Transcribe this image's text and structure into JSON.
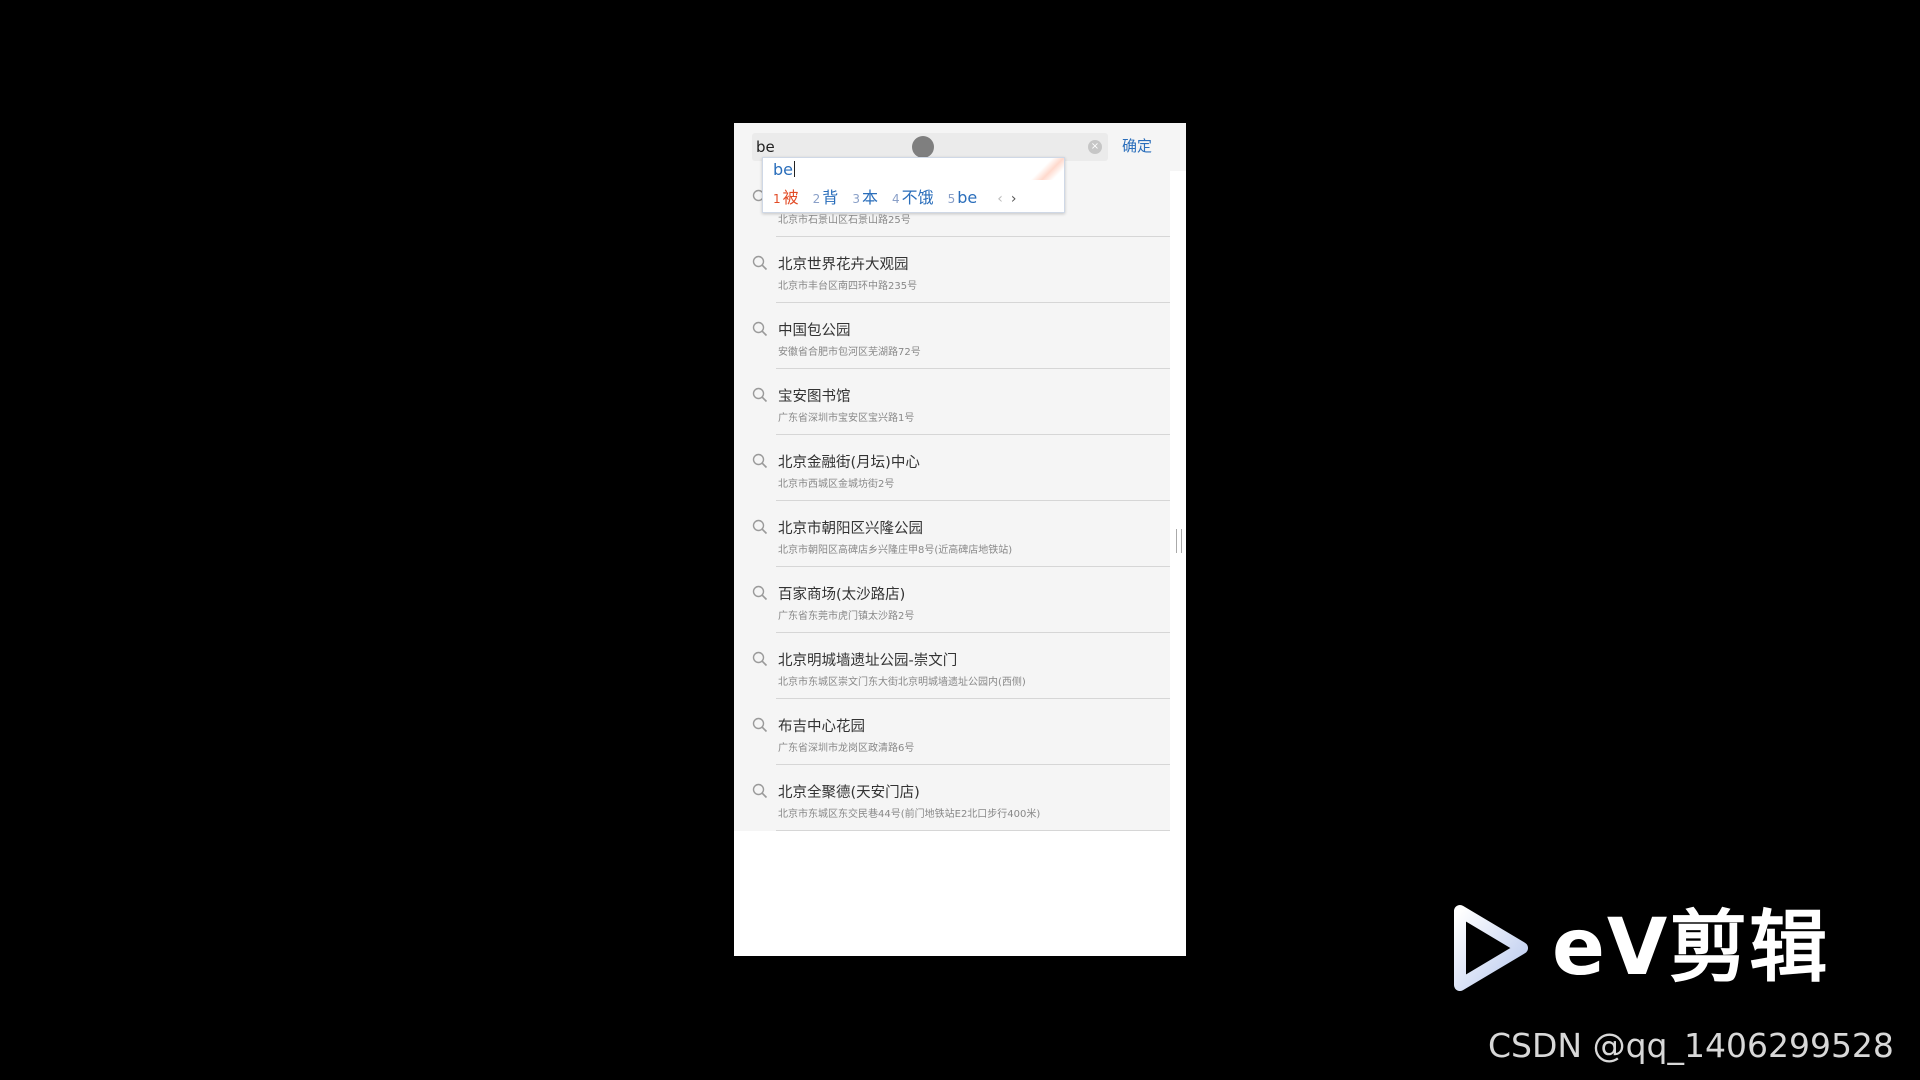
{
  "header": {
    "search_value": "be",
    "confirm_label": "确定"
  },
  "ime": {
    "composition": "be",
    "candidates": [
      {
        "num": "1",
        "text": "被"
      },
      {
        "num": "2",
        "text": "背"
      },
      {
        "num": "3",
        "text": "本"
      },
      {
        "num": "4",
        "text": "不饿"
      },
      {
        "num": "5",
        "text": "be"
      }
    ],
    "prev_label": "‹",
    "next_label": "›"
  },
  "results": [
    {
      "title": "",
      "addr": "北京市石景山区石景山路25号"
    },
    {
      "title": "北京世界花卉大观园",
      "addr": "北京市丰台区南四环中路235号"
    },
    {
      "title": "中国包公园",
      "addr": "安徽省合肥市包河区芜湖路72号"
    },
    {
      "title": "宝安图书馆",
      "addr": "广东省深圳市宝安区宝兴路1号"
    },
    {
      "title": "北京金融街(月坛)中心",
      "addr": "北京市西城区金城坊街2号"
    },
    {
      "title": "北京市朝阳区兴隆公园",
      "addr": "北京市朝阳区高碑店乡兴隆庄甲8号(近高碑店地铁站)"
    },
    {
      "title": "百家商场(太沙路店)",
      "addr": "广东省东莞市虎门镇太沙路2号"
    },
    {
      "title": "北京明城墙遗址公园-崇文门",
      "addr": "北京市东城区崇文门东大街北京明城墙遗址公园内(西侧)"
    },
    {
      "title": "布吉中心花园",
      "addr": "广东省深圳市龙岗区政清路6号"
    },
    {
      "title": "北京全聚德(天安门店)",
      "addr": "北京市东城区东交民巷44号(前门地铁站E2北口步行400米)"
    }
  ],
  "logo": {
    "text": "eV剪辑"
  },
  "watermark": {
    "text": "CSDN @qq_1406299528"
  }
}
